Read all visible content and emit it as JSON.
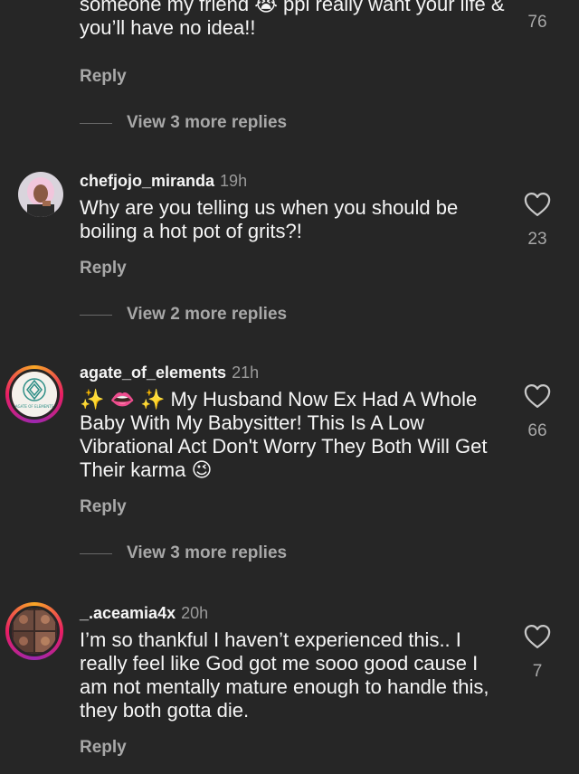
{
  "comments": [
    {
      "text": "someone my friend 😭 ppl really want your life & you’ll have no idea!!",
      "likes": "76",
      "reply_label": "Reply",
      "more_replies": "View 3 more replies"
    },
    {
      "username": "chefjojo_miranda",
      "time": "19h",
      "text": "Why are you telling us when you should be boiling a hot pot of grits?!",
      "likes": "23",
      "reply_label": "Reply",
      "more_replies": "View 2 more replies"
    },
    {
      "username": "agate_of_elements",
      "time": "21h",
      "text": "✨ 👄 ✨ My Husband Now Ex Had A Whole Baby With My Babysitter! This Is A Low Vibrational Act Don't Worry They Both Will Get Their karma 😉",
      "likes": "66",
      "reply_label": "Reply",
      "more_replies": "View 3 more replies",
      "avatar_text": "AGATE OF ELEMENTS"
    },
    {
      "username": "_.aceamia4x",
      "time": "20h",
      "text": "I’m so thankful I haven’t experienced this.. I really feel like God got me sooo good cause I am not mentally mature enough to handle this, they both gotta die.",
      "likes": "7",
      "reply_label": "Reply"
    }
  ],
  "colors": {
    "background": "#262626",
    "muted": "#a8a8a8",
    "text": "#f5f5f5"
  },
  "icons": [
    "heart-icon"
  ]
}
